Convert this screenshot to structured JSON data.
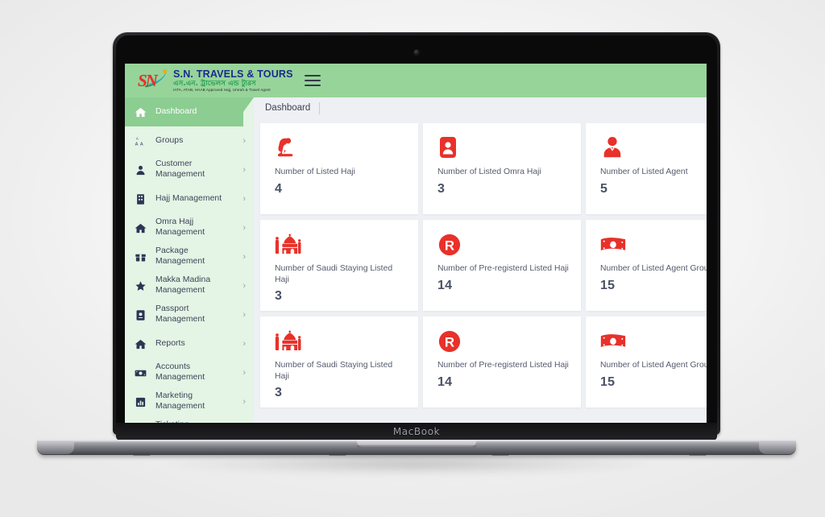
{
  "device": {
    "wordmark": "MacBook"
  },
  "header": {
    "brand_name": "S.N. TRAVELS & TOURS",
    "brand_bengali": "এস.এন. ট্রাভেলস এন্ড ট্যুরস",
    "brand_tagline": "IATA, ATAB, HAAB Approved Hajj, Umrah & Travel Agent",
    "logo_initials": "SN",
    "menu_icon": "hamburger-icon",
    "bar_color": "#97d49a"
  },
  "breadcrumb": {
    "current": "Dashboard"
  },
  "sidebar": {
    "bg_color": "#e4f4e5",
    "active_color": "#8ccd91",
    "items": [
      {
        "label": "Dashboard",
        "icon": "home-icon",
        "active": true,
        "chevron": false
      },
      {
        "label": "Groups",
        "icon": "groups-icon",
        "active": false,
        "chevron": true
      },
      {
        "label": "Customer Management",
        "icon": "user-icon",
        "active": false,
        "chevron": true
      },
      {
        "label": "Hajj Management",
        "icon": "building-icon",
        "active": false,
        "chevron": true
      },
      {
        "label": "Omra Hajj Management",
        "icon": "home-icon",
        "active": false,
        "chevron": true
      },
      {
        "label": "Package Management",
        "icon": "package-icon",
        "active": false,
        "chevron": true
      },
      {
        "label": "Makka Madina Management",
        "icon": "star-icon",
        "active": false,
        "chevron": true
      },
      {
        "label": "Passport Management",
        "icon": "passport-icon",
        "active": false,
        "chevron": true
      },
      {
        "label": "Reports",
        "icon": "home-icon",
        "active": false,
        "chevron": true
      },
      {
        "label": "Accounts Management",
        "icon": "money-icon",
        "active": false,
        "chevron": true
      },
      {
        "label": "Marketing Management",
        "icon": "chart-icon",
        "active": false,
        "chevron": true
      },
      {
        "label": "Ticketing Management",
        "icon": "ticket-icon",
        "active": false,
        "chevron": false
      }
    ]
  },
  "dashboard": {
    "accent_color": "#e8312a",
    "cards": [
      {
        "title": "Number of Listed Haji",
        "value": "4",
        "icon": "praying-person-icon"
      },
      {
        "title": "Number of Listed Omra Haji",
        "value": "3",
        "icon": "id-card-icon"
      },
      {
        "title": "Number of Listed Agent",
        "value": "5",
        "icon": "agent-person-icon"
      },
      {
        "title": "Number of Saudi Staying Listed Haji",
        "value": "3",
        "icon": "mosque-icon"
      },
      {
        "title": "Number of Pre-registerd Listed Haji",
        "value": "14",
        "icon": "r-badge-icon"
      },
      {
        "title": "Number of Listed Agent Group",
        "value": "15",
        "icon": "banknote-icon"
      },
      {
        "title": "Number of Saudi Staying Listed Haji",
        "value": "3",
        "icon": "mosque-icon"
      },
      {
        "title": "Number of Pre-registerd Listed Haji",
        "value": "14",
        "icon": "r-badge-icon"
      },
      {
        "title": "Number of Listed Agent Group",
        "value": "15",
        "icon": "banknote-icon"
      }
    ]
  }
}
